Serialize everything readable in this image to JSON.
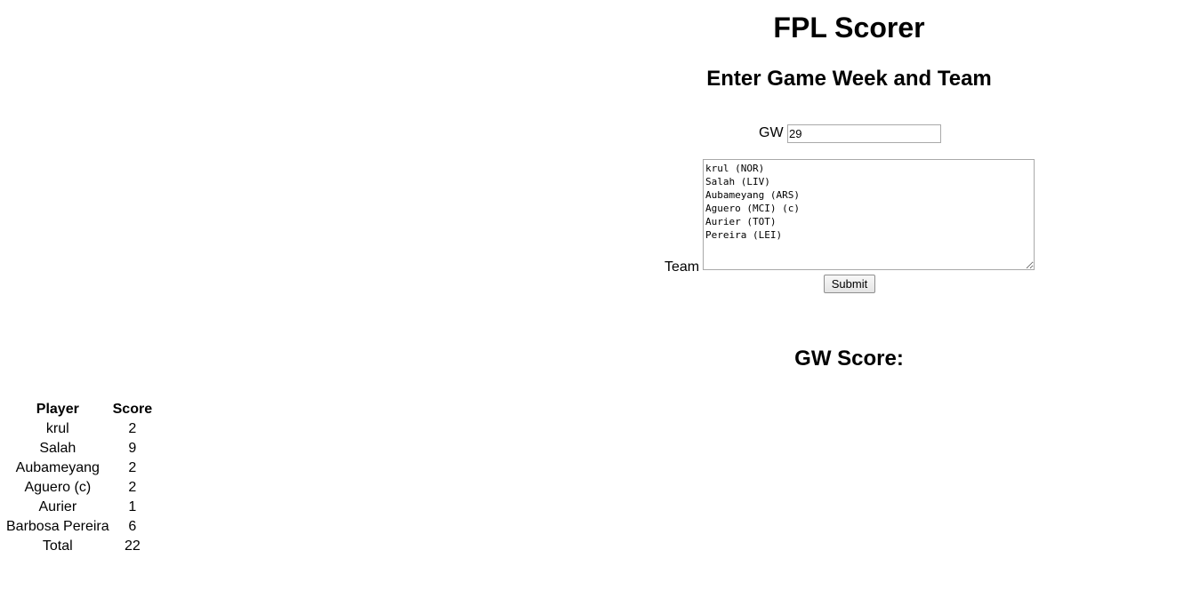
{
  "header": {
    "title": "FPL Scorer",
    "subtitle": "Enter Game Week and Team"
  },
  "form": {
    "gw_label": "GW",
    "gw_value": "29",
    "team_label": "Team",
    "team_value": "krul (NOR)\nSalah (LIV)\nAubameyang (ARS)\nAguero (MCI) (c)\nAurier (TOT)\nPereira (LEI)",
    "submit_label": "Submit"
  },
  "result": {
    "heading": "GW Score:"
  },
  "score_table": {
    "headers": {
      "player": "Player",
      "score": "Score"
    },
    "rows": [
      {
        "player": "krul",
        "score": "2"
      },
      {
        "player": "Salah",
        "score": "9"
      },
      {
        "player": "Aubameyang",
        "score": "2"
      },
      {
        "player": "Aguero (c)",
        "score": "2"
      },
      {
        "player": "Aurier",
        "score": "1"
      },
      {
        "player": "Barbosa Pereira",
        "score": "6"
      },
      {
        "player": "Total",
        "score": "22"
      }
    ]
  }
}
